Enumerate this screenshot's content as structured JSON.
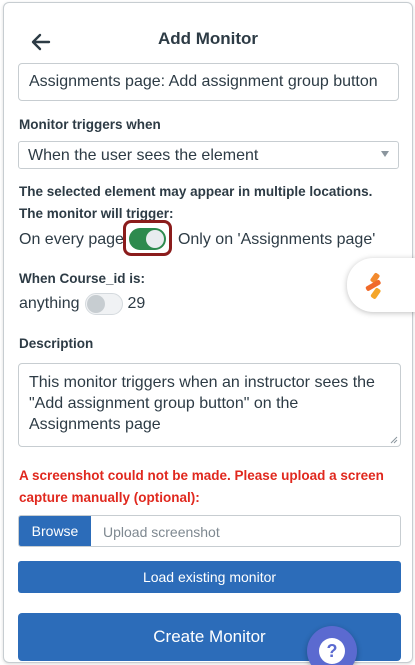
{
  "header": {
    "title": "Add Monitor"
  },
  "monitor_name": {
    "value": "Assignments page: Add assignment group button"
  },
  "triggers": {
    "label": "Monitor triggers when",
    "selected": "When the user sees the element"
  },
  "location": {
    "info_line1": "The selected element may appear in multiple locations.",
    "info_line2": "The monitor will trigger:",
    "left_option": "On every page",
    "right_option": "Only on 'Assignments page'",
    "toggle_on": true
  },
  "course": {
    "label": "When Course_id is:",
    "left_option": "anything",
    "right_option": "29",
    "toggle_on": false
  },
  "description": {
    "label": "Description",
    "value": "This monitor triggers when an instructor sees the \"Add assignment group button\" on the Assignments page"
  },
  "screenshot": {
    "error": "A screenshot could not be made. Please upload a screen capture manually (optional):",
    "browse_label": "Browse",
    "placeholder": "Upload screenshot"
  },
  "buttons": {
    "load": "Load existing monitor",
    "create": "Create Monitor"
  },
  "colors": {
    "primary": "#2c6cb9",
    "error": "#e0281e",
    "toggle_on": "#2d8a4e",
    "highlight": "#8b1c1c"
  }
}
